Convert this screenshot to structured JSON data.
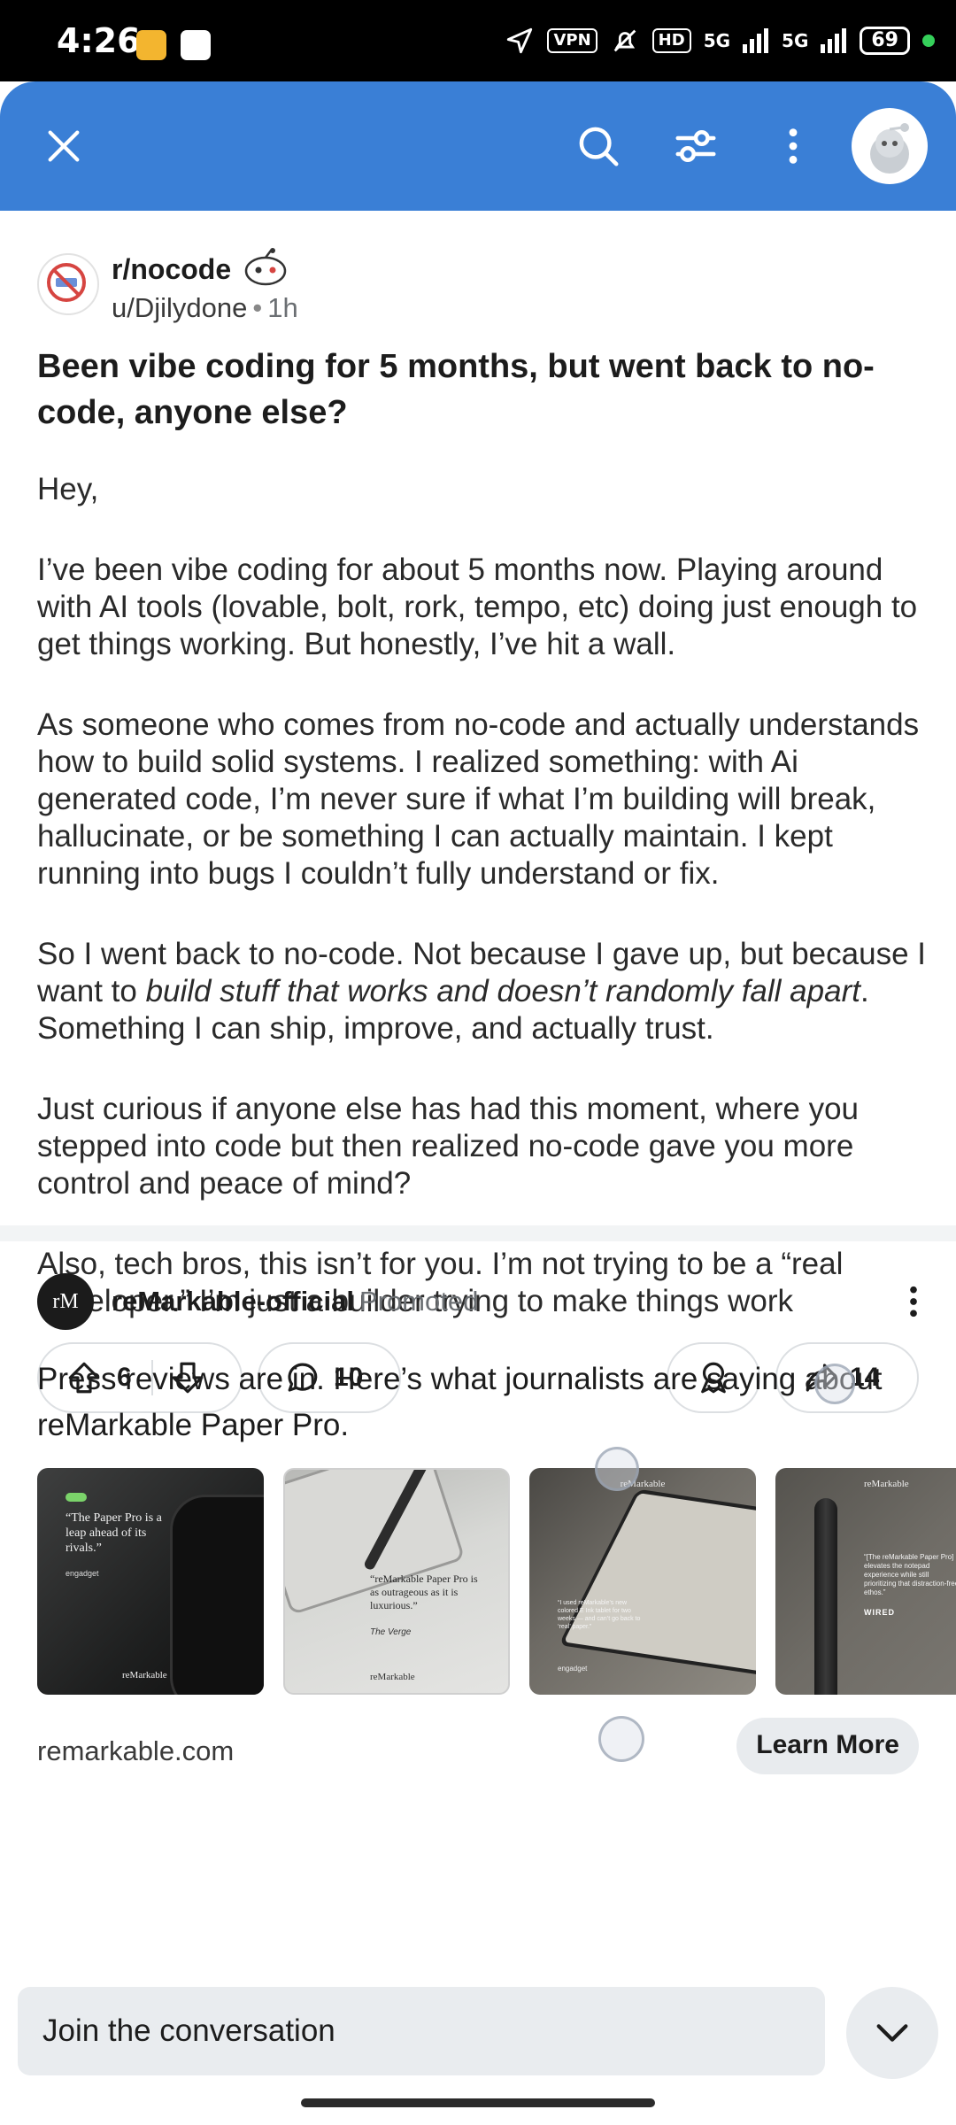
{
  "status_bar": {
    "time": "4:26",
    "vpn": "VPN",
    "hd": "HD",
    "net1": "5G",
    "net2": "5G",
    "battery": "69"
  },
  "post": {
    "subreddit": "r/nocode",
    "author": "u/Djilydone",
    "age": "1h",
    "title": "Been vibe coding for 5 months, but went back to no-code, anyone else?",
    "body": [
      "Hey,",
      "I’ve been vibe coding for about 5 months now. Playing around with AI tools (lovable, bolt, rork, tempo, etc) doing just enough to get things working. But honestly, I’ve hit a wall.",
      "As someone who comes from no-code and actually understands how to build solid systems. I realized something: with Ai generated code, I’m never sure if what I’m building will break, hallucinate, or be something I can actually maintain. I kept running into bugs I couldn’t fully understand or fix."
    ],
    "para4_start": "So I went back to no-code. Not because I gave up, but because I want to ",
    "para4_italic": "build stuff that works and doesn’t randomly fall apart",
    "para4_end": ". Something I can ship, improve, and actually trust.",
    "para5": "Just curious if anyone else has had this moment, where you stepped into code but then realized no-code gave you more control and peace of mind?",
    "para6": "Also, tech bros, this isn’t for you. I’m not trying to be a “real developer.” I’m just a builder trying to make things work",
    "upvotes": "6",
    "comments": "10",
    "shares": "14"
  },
  "promo": {
    "logo_text": "rM",
    "advertiser": "reMarkable-official",
    "tag": "Promoted",
    "text": "Press reviews are in. Here’s what journalists are saying about reMarkable Paper Pro.",
    "cards": [
      {
        "brand": "reMarkable",
        "quote": "“The Paper Pro is a leap ahead of its rivals.”",
        "source": "engadget"
      },
      {
        "brand": "reMarkable",
        "quote": "“reMarkable Paper Pro is as outrageous as it is luxurious.”",
        "source": "The Verge"
      },
      {
        "brand": "reMarkable",
        "quote": "“I used reMarkable’s new colored E Ink tablet for two weeks — and can’t go back to ‘real’ paper.”",
        "source": "engadget"
      },
      {
        "brand": "reMarkable",
        "quote": "“[The reMarkable Paper Pro] elevates the notepad experience while still prioritizing that distraction-free ethos.”",
        "source": "WIRED"
      }
    ],
    "domain": "remarkable.com",
    "cta": "Learn More"
  },
  "composer": {
    "placeholder": "Join the conversation"
  },
  "colors": {
    "header_blue": "#3a7fd6",
    "band_gray": "#f2f4f5"
  }
}
